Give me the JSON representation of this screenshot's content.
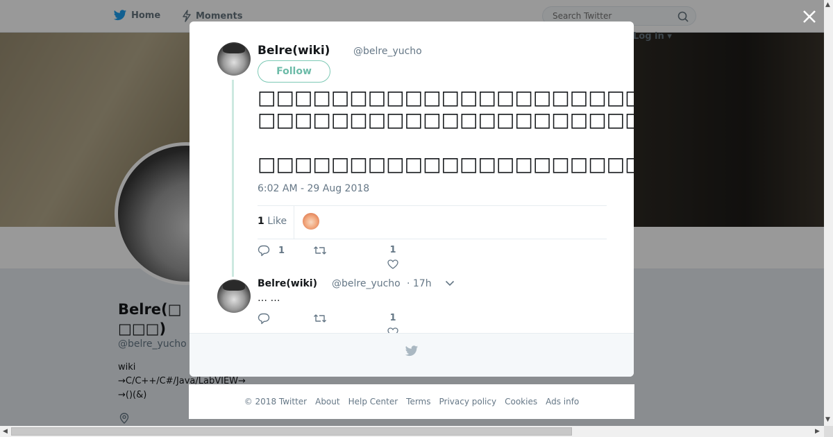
{
  "nav": {
    "home": "Home",
    "moments": "Moments",
    "search_placeholder": "Search Twitter",
    "login": "Log in"
  },
  "profile": {
    "name": "Belre(□□□□)",
    "handle": "@belre_yucho",
    "bio": [
      "wiki",
      "→C/C++/C#/Java/LabVIEW→",
      "→()(&)"
    ]
  },
  "tweet": {
    "author_name": "Belre(wiki)",
    "author_handle": "@belre_yucho",
    "follow_label": "Follow",
    "text": "□□□□□□□□□□□□□□□□□□□□□□□□□\n□□□□□□□□□□□□□□□□□□□□□□□□□□□□□□□□□□□□□□□□□□□□□□□□□□\n\n□□□□□□□□□□□□□□□□□□□□□□□□□",
    "timestamp": "6:02 AM - 29 Aug 2018",
    "likes_count": "1",
    "likes_label": "Like",
    "reply_count": "1",
    "like_count": "1"
  },
  "reply": {
    "author_name": "Belre(wiki)",
    "author_handle": "@belre_yucho",
    "time": "· 17h",
    "text": "… …",
    "like_count": "1"
  },
  "footer": {
    "links": [
      "© 2018 Twitter",
      "About",
      "Help Center",
      "Terms",
      "Privacy policy",
      "Cookies",
      "Ads info"
    ]
  },
  "colors": {
    "accent": "#1da1f2",
    "follow": "#6cbba8",
    "thread_line": "#cde9e0"
  }
}
